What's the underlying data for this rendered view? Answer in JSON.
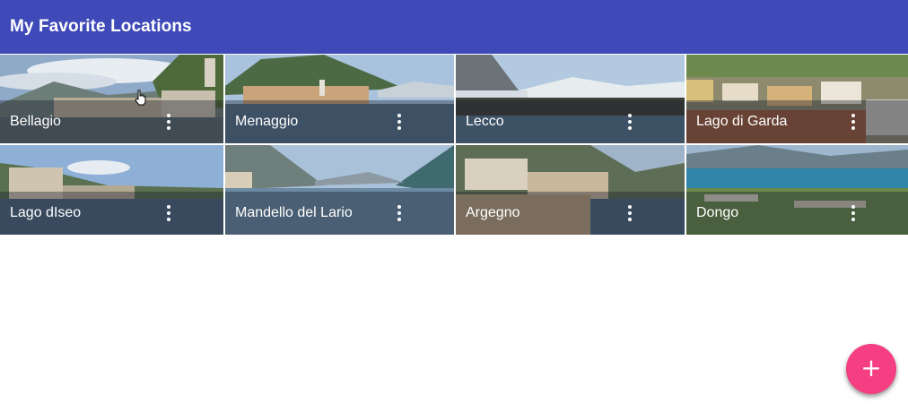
{
  "app_bar": {
    "title": "My Favorite Locations",
    "color": "#3f4ab8"
  },
  "tiles": [
    {
      "label": "Bellagio",
      "more_icon": "more-vert-icon"
    },
    {
      "label": "Menaggio",
      "more_icon": "more-vert-icon"
    },
    {
      "label": "Lecco",
      "more_icon": "more-vert-icon"
    },
    {
      "label": "Lago di Garda",
      "more_icon": "more-vert-icon"
    },
    {
      "label": "Lago dIseo",
      "more_icon": "more-vert-icon"
    },
    {
      "label": "Mandello del Lario",
      "more_icon": "more-vert-icon"
    },
    {
      "label": "Argegno",
      "more_icon": "more-vert-icon"
    },
    {
      "label": "Dongo",
      "more_icon": "more-vert-icon"
    }
  ],
  "fab": {
    "icon": "plus-icon",
    "glyph": "+",
    "color": "#f53f82"
  },
  "cursor": {
    "icon": "hand-pointer-icon"
  }
}
